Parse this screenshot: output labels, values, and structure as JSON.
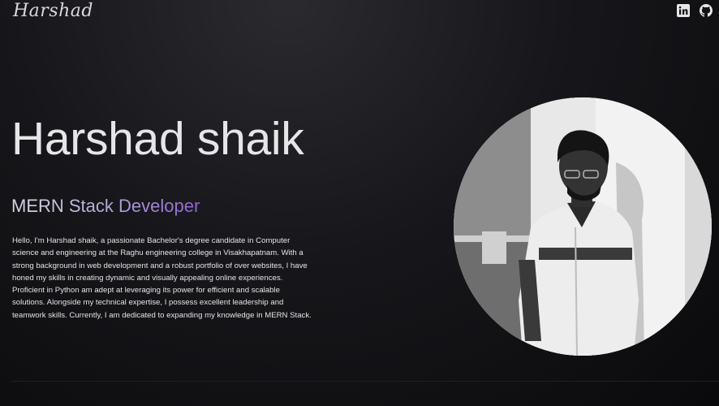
{
  "navbar": {
    "logo": "Harshad",
    "icons": [
      "linkedin-icon",
      "github-icon"
    ]
  },
  "hero": {
    "name": "Harshad shaik",
    "role": "MERN Stack Developer",
    "bio": "Hello, I'm Harshad shaik, a passionate Bachelor's degree candidate in Computer science and engineering at the Raghu engineering college in Visakhapatnam. With a strong background in web development and a robust portfolio of over websites, I have honed my skills in creating dynamic and visually appealing online experiences. Proficient in Python am adept at leveraging its power for efficient and scalable solutions. Alongside my technical expertise, I possess excellent leadership and teamwork skills. Currently, I am dedicated to expanding my knowledge in MERN Stack."
  },
  "colors": {
    "background": "#0d0d10",
    "role_gradient_start": "#d8d8e0",
    "role_gradient_end": "#8d63d6"
  }
}
